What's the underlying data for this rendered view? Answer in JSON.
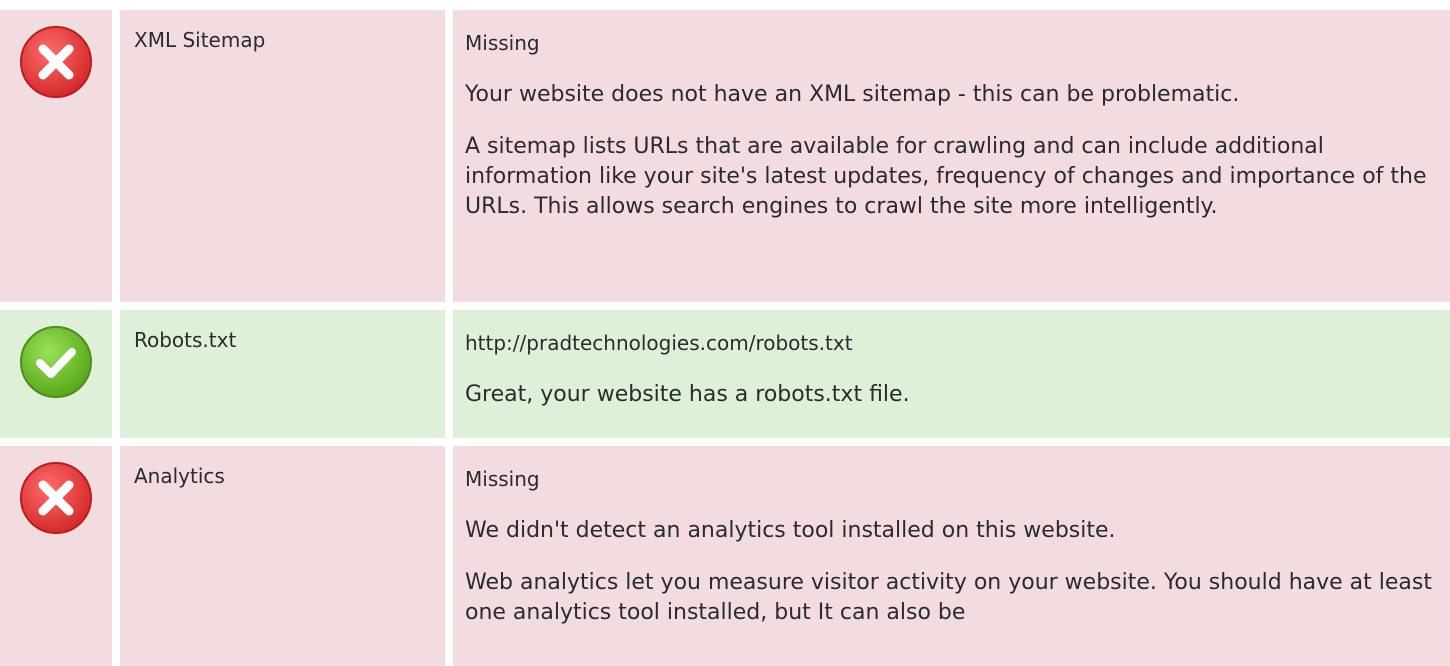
{
  "checks": [
    {
      "status": "fail",
      "icon": "error-icon",
      "label": "XML Sitemap",
      "value": "Missing",
      "paragraphs": [
        "Your website does not have an XML sitemap - this can be problematic.",
        "A sitemap lists URLs that are available for crawling and can include additional information like your site's latest updates, frequency of changes and importance of the URLs. This allows search engines to crawl the site more intelligently."
      ]
    },
    {
      "status": "pass",
      "icon": "success-icon",
      "label": "Robots.txt",
      "value": "http://pradtechnologies.com/robots.txt",
      "paragraphs": [
        "Great, your website has a robots.txt file."
      ]
    },
    {
      "status": "fail",
      "icon": "error-icon",
      "label": "Analytics",
      "value": "Missing",
      "paragraphs": [
        "We didn't detect an analytics tool installed on this website.",
        "Web analytics let you measure visitor activity on your website. You should have at least one analytics tool installed, but It can also be"
      ]
    }
  ],
  "colors": {
    "fail_bg": "#f3dcdf",
    "pass_bg": "#dff0d8",
    "error_red": "#e23b3b",
    "success_green": "#6cc024"
  }
}
